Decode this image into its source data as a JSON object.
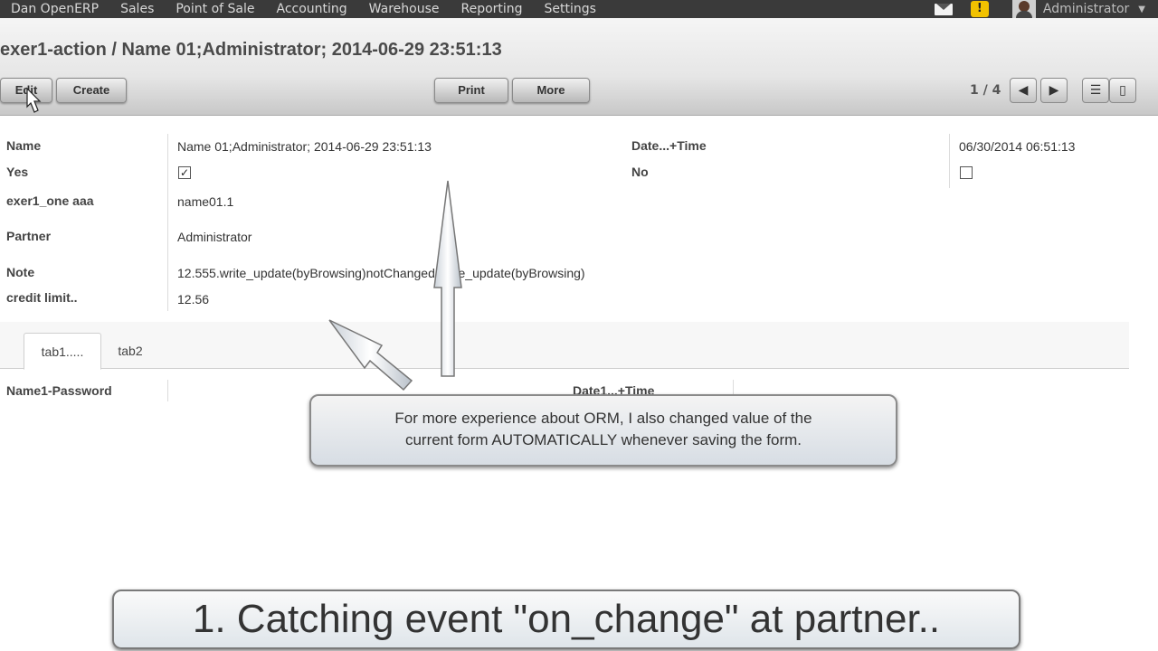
{
  "topbar": {
    "menu": [
      "Dan OpenERP",
      "Sales",
      "Point of Sale",
      "Accounting",
      "Warehouse",
      "Reporting",
      "Settings"
    ],
    "user": "Administrator",
    "warning_glyph": "!"
  },
  "header": {
    "title": "exer1-action / Name 01;Administrator; 2014-06-29 23:51:13",
    "edit_label": "Edit",
    "create_label": "Create",
    "print_label": "Print",
    "more_label": "More",
    "pager": "1 / 4"
  },
  "form": {
    "name_label": "Name",
    "name_value": "Name 01;Administrator; 2014-06-29 23:51:13",
    "date_label": "Date...+Time",
    "date_value": "06/30/2014 06:51:13",
    "yes_label": "Yes",
    "yes_checked": true,
    "no_label": "No",
    "no_checked": false,
    "one_label": "exer1_one aaa",
    "one_value": "name01.1",
    "partner_label": "Partner",
    "partner_value": "Administrator",
    "note_label": "Note",
    "note_value": "12.555.write_update(byBrowsing)notChanged.write_update(byBrowsing)",
    "credit_label": "credit limit..",
    "credit_value": "12.56"
  },
  "tabs": [
    "tab1.....",
    "tab2"
  ],
  "tab1": {
    "password_label": "Name1-Password",
    "date1_label": "Date1...+Time"
  },
  "callout": {
    "line1": "For more experience about ORM, I also changed value of the",
    "line2": "current form AUTOMATICALLY whenever saving the form."
  },
  "caption": "1. Catching event \"on_change\" at partner..",
  "icons": {
    "mail": "mail-icon",
    "warning": "warning-icon",
    "prev": "arrow-left-icon",
    "next": "arrow-right-icon",
    "list_view": "list-view-icon",
    "form_view": "form-view-icon",
    "checkbox_checked": "✓"
  }
}
